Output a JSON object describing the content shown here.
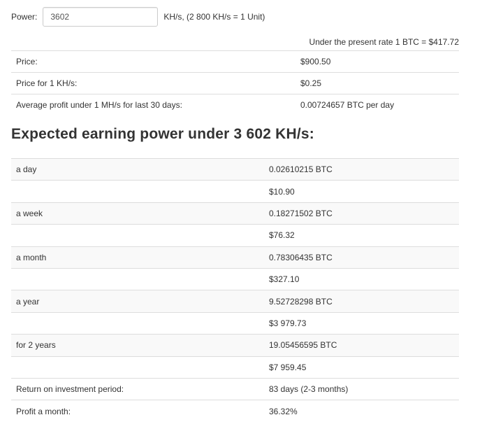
{
  "power": {
    "label": "Power:",
    "value": "3602",
    "unit_note": "KH/s, (2 800 KH/s = 1 Unit)"
  },
  "rate_note": "Under the present rate 1 BTC = $417.72",
  "price_table": [
    {
      "label": "Price:",
      "value": "$900.50"
    },
    {
      "label": "Price for 1 KH/s:",
      "value": "$0.25"
    },
    {
      "label": "Average profit under 1 MH/s for last 30 days:",
      "value": "0.00724657 BTC per day"
    }
  ],
  "earnings_heading": "Expected earning power under 3 602 KH/s:",
  "earnings_table": [
    {
      "label": "a day",
      "value": "0.02610215 BTC"
    },
    {
      "label": "",
      "value": "$10.90"
    },
    {
      "label": "a week",
      "value": "0.18271502 BTC"
    },
    {
      "label": "",
      "value": "$76.32"
    },
    {
      "label": "a month",
      "value": "0.78306435 BTC"
    },
    {
      "label": "",
      "value": "$327.10"
    },
    {
      "label": "a year",
      "value": "9.52728298 BTC"
    },
    {
      "label": "",
      "value": "$3 979.73"
    },
    {
      "label": "for 2 years",
      "value": "19.05456595 BTC"
    },
    {
      "label": "",
      "value": "$7 959.45"
    },
    {
      "label": "Return on investment period:",
      "value": "83 days (2-3 months)"
    },
    {
      "label": "Profit a month:",
      "value": "36.32%"
    }
  ]
}
